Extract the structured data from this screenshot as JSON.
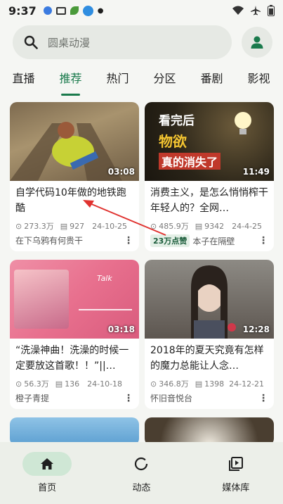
{
  "status_bar": {
    "time": "9:37"
  },
  "search": {
    "placeholder": "圆桌动漫"
  },
  "tabs": [
    {
      "label": "直播"
    },
    {
      "label": "推荐"
    },
    {
      "label": "热门"
    },
    {
      "label": "分区"
    },
    {
      "label": "番剧"
    },
    {
      "label": "影视"
    }
  ],
  "active_tab": "推荐",
  "cards": [
    {
      "duration": "03:08",
      "title": "自学代码10年做的地铁跑酷",
      "views": "273.3万",
      "danmaku": "927",
      "date": "24-10-25",
      "author": "在下乌鸦有何贵干",
      "badge": ""
    },
    {
      "duration": "11:49",
      "title": "消费主义，是怎么悄悄榨干年轻人的？全网…",
      "views": "485.9万",
      "danmaku": "9342",
      "date": "24-4-25",
      "author": "本子在隔壁",
      "badge": "23万点赞",
      "thumb_text_1": "看完后",
      "thumb_text_2": "物欲",
      "thumb_text_3": "真的消失了"
    },
    {
      "duration": "03:18",
      "title": "“洗澡神曲！洗澡的时候一定要放这首歌！！”||…",
      "views": "56.3万",
      "danmaku": "136",
      "date": "24-10-18",
      "author": "橙子青提",
      "badge": "",
      "thumb_text_1": "Talk"
    },
    {
      "duration": "12:28",
      "title": "2018年的夏天究竟有怎样的魔力总能让人念…",
      "views": "346.8万",
      "danmaku": "1398",
      "date": "24-12-21",
      "author": "怀旧音悦台",
      "badge": ""
    }
  ],
  "bottom_nav": [
    {
      "label": "首页"
    },
    {
      "label": "动态"
    },
    {
      "label": "媒体库"
    }
  ],
  "colors": {
    "accent": "#1a7a4c",
    "background": "#f5f6f3",
    "annotation_arrow": "#e0322f"
  }
}
